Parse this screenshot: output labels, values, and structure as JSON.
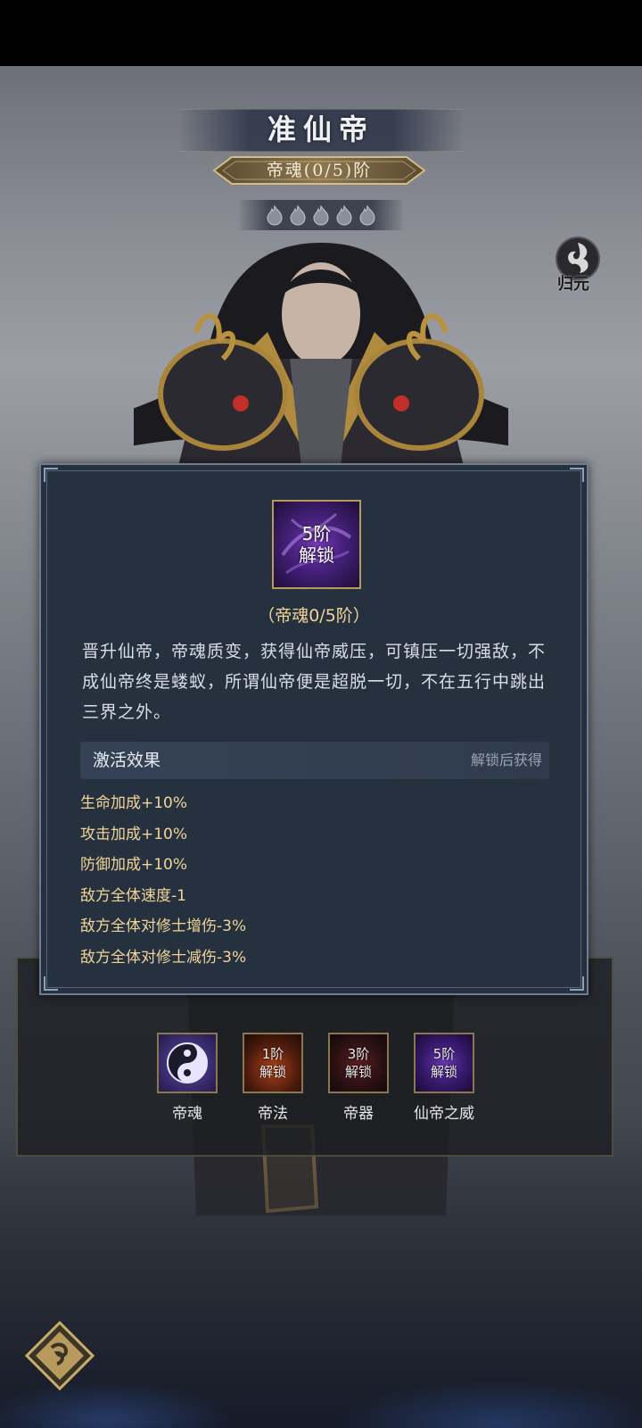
{
  "header": {
    "title": "准仙帝",
    "rank": "帝魂(0/5)阶",
    "flame_count": 5
  },
  "side_button": {
    "label": "归元",
    "icon": "guiyuan-swirl-icon"
  },
  "popup": {
    "icon_text_line1": "5阶",
    "icon_text_line2": "解锁",
    "subtitle": "（帝魂0/5阶）",
    "description": "晋升仙帝，帝魂质变，获得仙帝威压，可镇压一切强敌，不成仙帝终是蝼蚁，所谓仙帝便是超脱一切，不在五行中跳出三界之外。",
    "effect_header": "激活效果",
    "effect_note": "解锁后获得",
    "effects": [
      "生命加成+10%",
      "攻击加成+10%",
      "防御加成+10%",
      "敌方全体速度-1",
      "敌方全体对修士增伤-3%",
      "敌方全体对修士减伤-3%"
    ]
  },
  "skills": [
    {
      "name": "帝魂",
      "icon": "yin-yang-icon",
      "lock_line1": "",
      "lock_line2": ""
    },
    {
      "name": "帝法",
      "icon": "fire-figure-icon",
      "lock_line1": "1阶",
      "lock_line2": "解锁"
    },
    {
      "name": "帝器",
      "icon": "dark-artifact-icon",
      "lock_line1": "3阶",
      "lock_line2": "解锁"
    },
    {
      "name": "仙帝之威",
      "icon": "purple-aura-icon",
      "lock_line1": "5阶",
      "lock_line2": "解锁"
    }
  ],
  "colors": {
    "popup_bg": "#263140",
    "gold_text": "#f2d497",
    "desc_text": "#d9dde4",
    "frame_gold": "#b99a5a"
  }
}
